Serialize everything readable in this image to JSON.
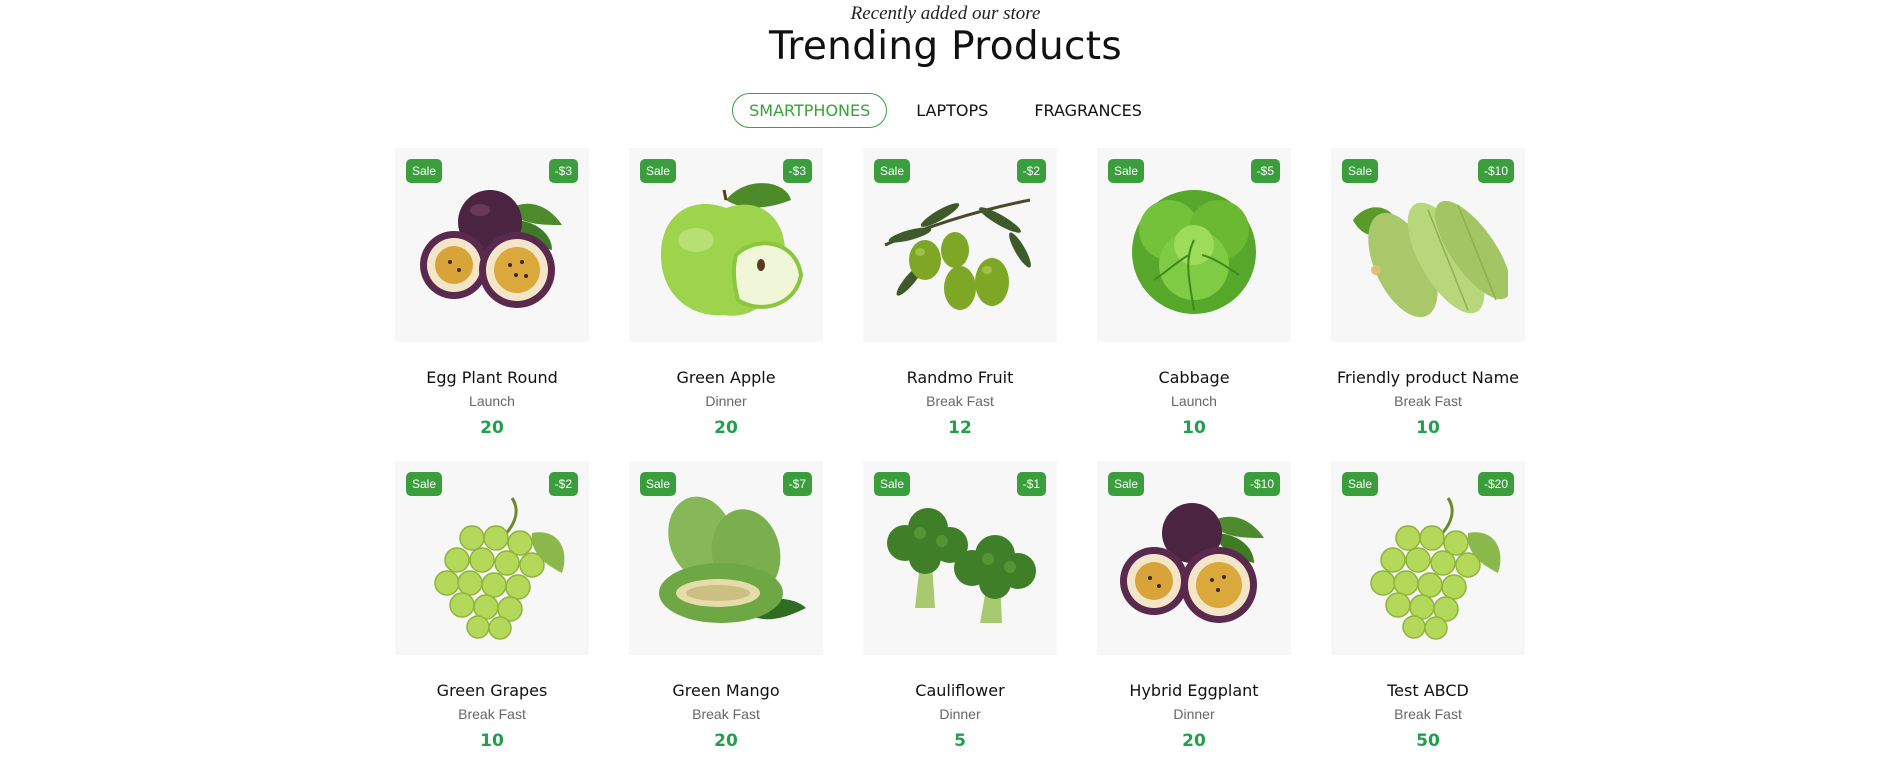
{
  "header": {
    "subtitle": "Recently added our store",
    "title": "Trending Products"
  },
  "tabs": [
    {
      "label": "SMARTPHONES",
      "active": true
    },
    {
      "label": "LAPTOPS",
      "active": false
    },
    {
      "label": "FRAGRANCES",
      "active": false
    }
  ],
  "colors": {
    "accent": "#3aa13a",
    "badge": "#3a9e3d",
    "price": "#20a04a"
  },
  "products": [
    {
      "sale": "Sale",
      "discount": "-$3",
      "name": "Egg Plant Round",
      "category": "Launch",
      "price": "20",
      "icon": "passion-fruit-icon"
    },
    {
      "sale": "Sale",
      "discount": "-$3",
      "name": "Green Apple",
      "category": "Dinner",
      "price": "20",
      "icon": "green-apple-icon"
    },
    {
      "sale": "Sale",
      "discount": "-$2",
      "name": "Randmo Fruit",
      "category": "Break Fast",
      "price": "12",
      "icon": "olives-icon"
    },
    {
      "sale": "Sale",
      "discount": "-$5",
      "name": "Cabbage",
      "category": "Launch",
      "price": "10",
      "icon": "cabbage-icon"
    },
    {
      "sale": "Sale",
      "discount": "-$10",
      "name": "Friendly product Name",
      "category": "Break Fast",
      "price": "10",
      "icon": "zucchini-icon"
    },
    {
      "sale": "Sale",
      "discount": "-$2",
      "name": "Green Grapes",
      "category": "Break Fast",
      "price": "10",
      "icon": "grapes-icon"
    },
    {
      "sale": "Sale",
      "discount": "-$7",
      "name": "Green Mango",
      "category": "Break Fast",
      "price": "20",
      "icon": "mango-icon"
    },
    {
      "sale": "Sale",
      "discount": "-$1",
      "name": "Cauliflower",
      "category": "Dinner",
      "price": "5",
      "icon": "broccoli-icon"
    },
    {
      "sale": "Sale",
      "discount": "-$10",
      "name": "Hybrid Eggplant",
      "category": "Dinner",
      "price": "20",
      "icon": "passion-fruit-icon"
    },
    {
      "sale": "Sale",
      "discount": "-$20",
      "name": "Test ABCD",
      "category": "Break Fast",
      "price": "50",
      "icon": "grapes-icon"
    }
  ]
}
